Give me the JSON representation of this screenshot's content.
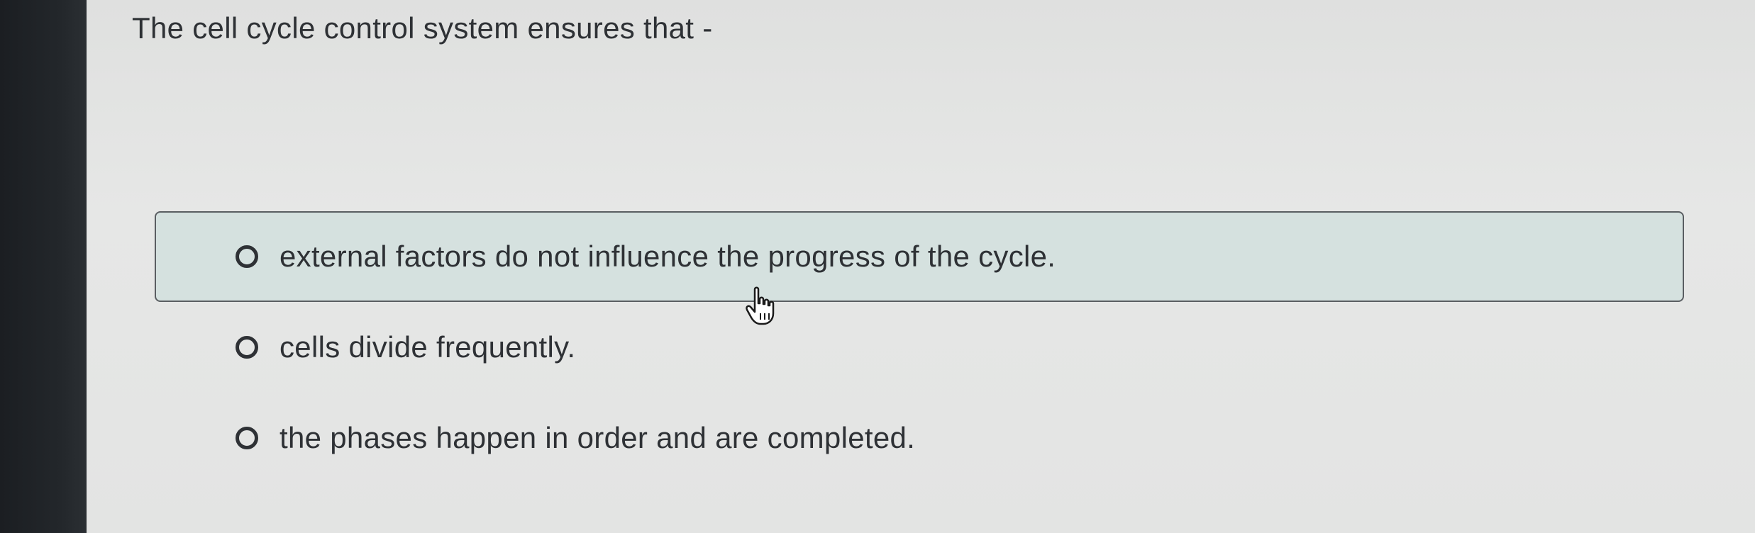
{
  "question": {
    "text": "The cell cycle control system ensures that -"
  },
  "options": [
    {
      "label": "external factors do not influence the progress of the cycle.",
      "hovered": true
    },
    {
      "label": "cells divide frequently.",
      "hovered": false
    },
    {
      "label": "the phases happen in order and are completed.",
      "hovered": false
    }
  ],
  "cursor": {
    "icon": "hand-pointer-icon"
  }
}
